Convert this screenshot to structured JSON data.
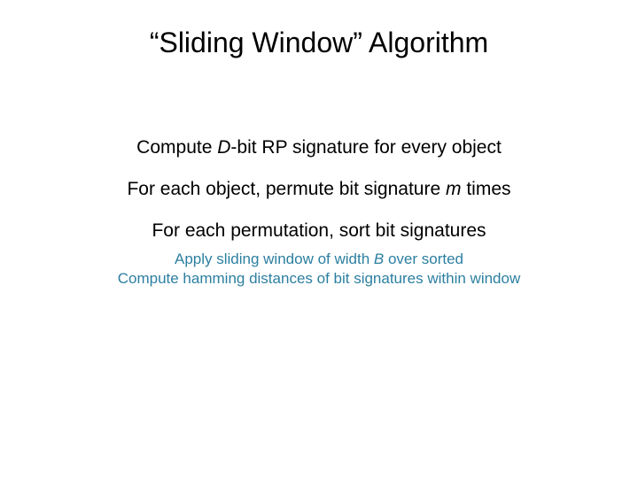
{
  "title": "“Sliding Window” Algorithm",
  "step1_pre": "Compute ",
  "step1_var": "D",
  "step1_post": "-bit RP signature for every object",
  "step2_pre": "For each object, permute bit signature ",
  "step2_var": "m",
  "step2_post": " times",
  "step3": "For each permutation, sort bit signatures",
  "sub1_pre": "Apply sliding window of width ",
  "sub1_var": "B",
  "sub1_post": " over sorted",
  "sub2": "Compute hamming distances of bit signatures within window"
}
